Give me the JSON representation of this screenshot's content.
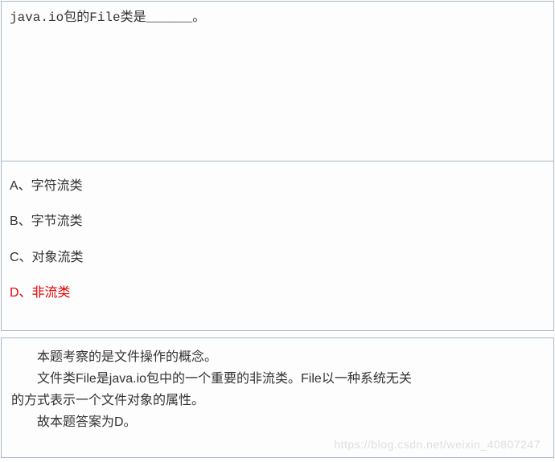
{
  "question": {
    "text": "java.io包的File类是______。"
  },
  "options": [
    {
      "label": "A、字符流类",
      "correct": false
    },
    {
      "label": "B、字节流类",
      "correct": false
    },
    {
      "label": "C、对象流类",
      "correct": false
    },
    {
      "label": "D、非流类",
      "correct": true
    }
  ],
  "explanation": {
    "line1": "本题考察的是文件操作的概念。",
    "line2a": "文件类File是java.io包中的一个重要的非流类。File以一种系统无关",
    "line2b": "的方式表示一个文件对象的属性。",
    "line3": "故本题答案为D。"
  },
  "watermark": "https://blog.csdn.net/weixin_40807247"
}
